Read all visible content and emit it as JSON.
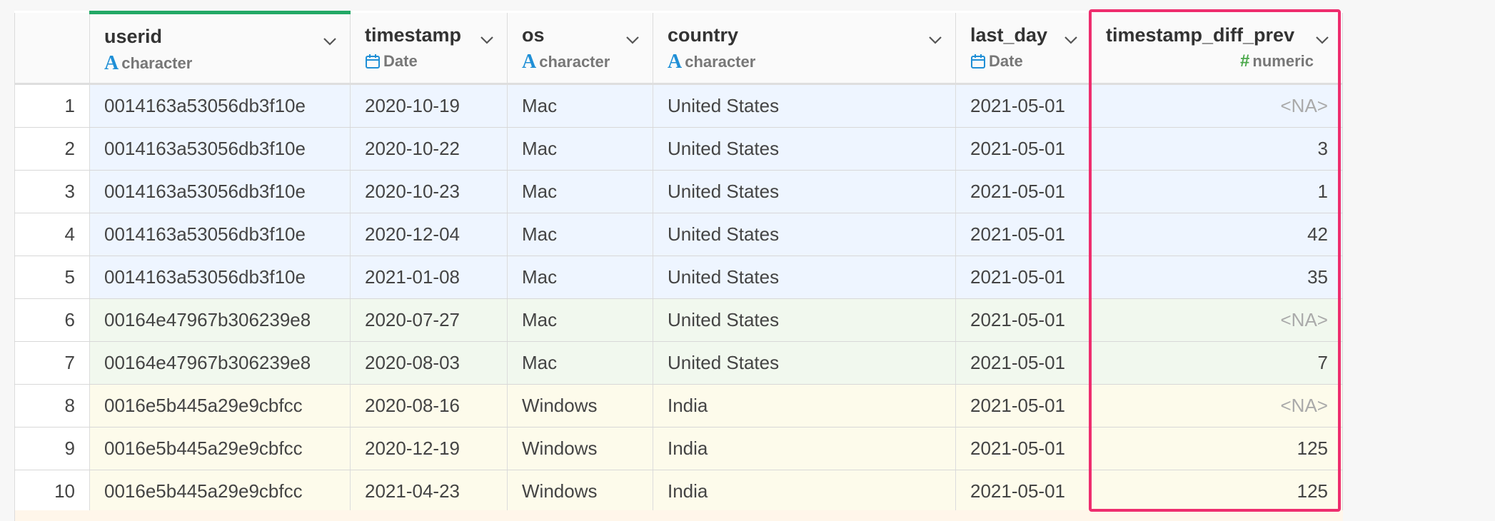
{
  "colors": {
    "user_group_1": "#eef5ff",
    "user_group_2": "#f1f8ee",
    "user_group_3": "#fdfbeb",
    "active_column_indicator": "#22a866",
    "highlight_box": "#ee2d6e",
    "character_icon": "#1f8fd6",
    "numeric_icon": "#4aa84a"
  },
  "columns": [
    {
      "name": "userid",
      "type": "character",
      "type_icon": "character-icon"
    },
    {
      "name": "timestamp",
      "type": "Date",
      "type_icon": "calendar-icon"
    },
    {
      "name": "os",
      "type": "character",
      "type_icon": "character-icon"
    },
    {
      "name": "country",
      "type": "character",
      "type_icon": "character-icon"
    },
    {
      "name": "last_day",
      "type": "Date",
      "type_icon": "calendar-icon"
    },
    {
      "name": "timestamp_diff_prev",
      "type": "numeric",
      "type_icon": "numeric-icon"
    }
  ],
  "rows": [
    {
      "n": "1",
      "group": 1,
      "userid": "0014163a53056db3f10e",
      "timestamp": "2020-10-19",
      "os": "Mac",
      "country": "United States",
      "last_day": "2021-05-01",
      "diff": "<NA>"
    },
    {
      "n": "2",
      "group": 1,
      "userid": "0014163a53056db3f10e",
      "timestamp": "2020-10-22",
      "os": "Mac",
      "country": "United States",
      "last_day": "2021-05-01",
      "diff": "3"
    },
    {
      "n": "3",
      "group": 1,
      "userid": "0014163a53056db3f10e",
      "timestamp": "2020-10-23",
      "os": "Mac",
      "country": "United States",
      "last_day": "2021-05-01",
      "diff": "1"
    },
    {
      "n": "4",
      "group": 1,
      "userid": "0014163a53056db3f10e",
      "timestamp": "2020-12-04",
      "os": "Mac",
      "country": "United States",
      "last_day": "2021-05-01",
      "diff": "42"
    },
    {
      "n": "5",
      "group": 1,
      "userid": "0014163a53056db3f10e",
      "timestamp": "2021-01-08",
      "os": "Mac",
      "country": "United States",
      "last_day": "2021-05-01",
      "diff": "35"
    },
    {
      "n": "6",
      "group": 2,
      "userid": "00164e47967b306239e8",
      "timestamp": "2020-07-27",
      "os": "Mac",
      "country": "United States",
      "last_day": "2021-05-01",
      "diff": "<NA>"
    },
    {
      "n": "7",
      "group": 2,
      "userid": "00164e47967b306239e8",
      "timestamp": "2020-08-03",
      "os": "Mac",
      "country": "United States",
      "last_day": "2021-05-01",
      "diff": "7"
    },
    {
      "n": "8",
      "group": 3,
      "userid": "0016e5b445a29e9cbfcc",
      "timestamp": "2020-08-16",
      "os": "Windows",
      "country": "India",
      "last_day": "2021-05-01",
      "diff": "<NA>"
    },
    {
      "n": "9",
      "group": 3,
      "userid": "0016e5b445a29e9cbfcc",
      "timestamp": "2020-12-19",
      "os": "Windows",
      "country": "India",
      "last_day": "2021-05-01",
      "diff": "125"
    },
    {
      "n": "10",
      "group": 3,
      "userid": "0016e5b445a29e9cbfcc",
      "timestamp": "2021-04-23",
      "os": "Windows",
      "country": "India",
      "last_day": "2021-05-01",
      "diff": "125"
    }
  ]
}
